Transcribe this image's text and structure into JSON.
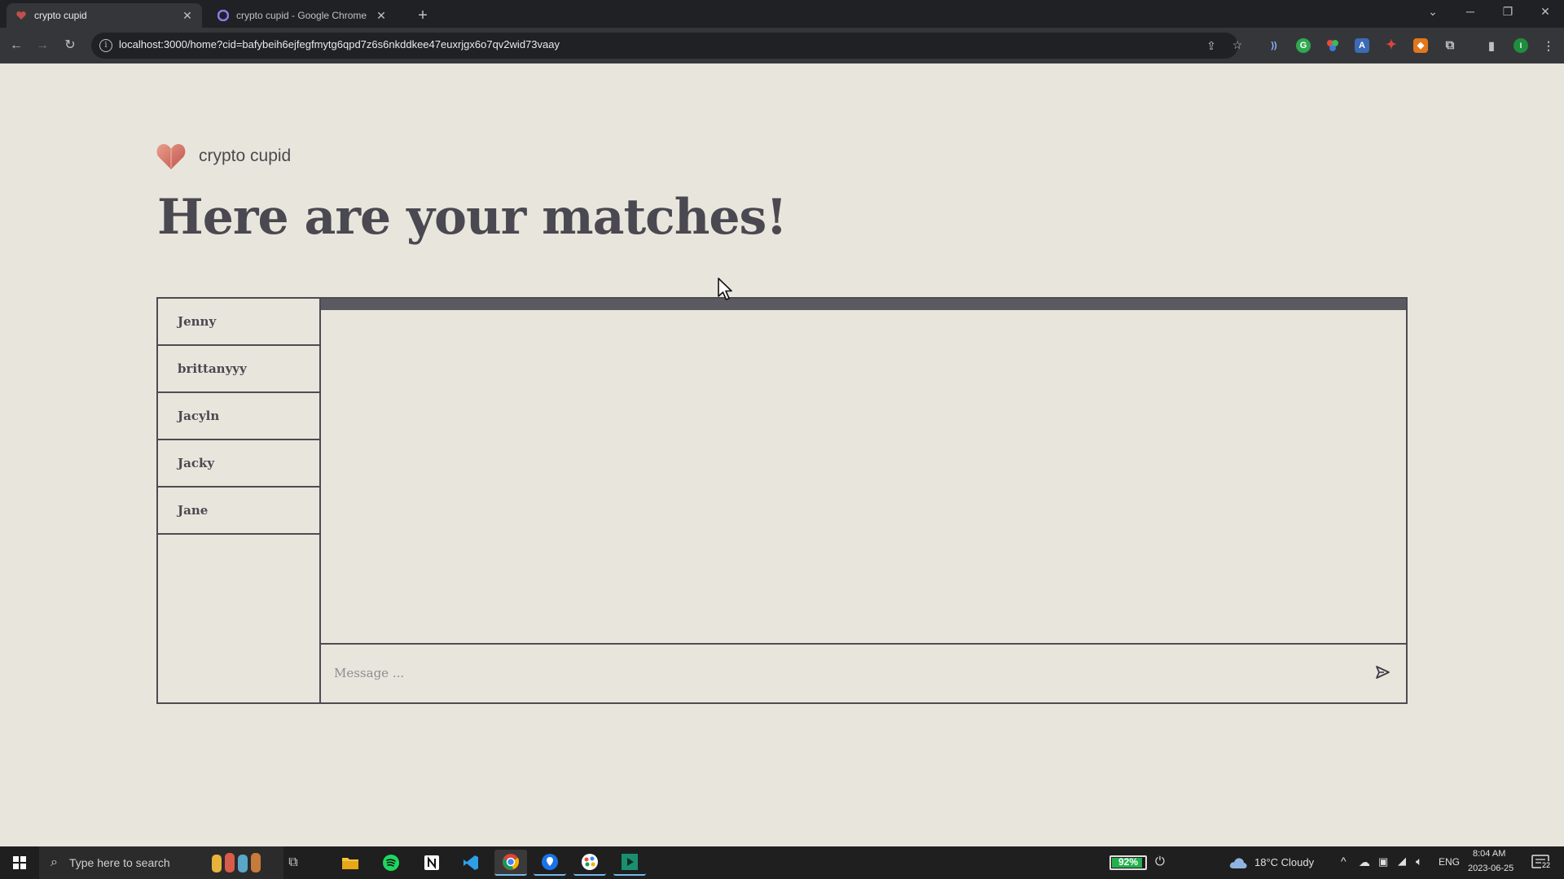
{
  "browser": {
    "tabs": [
      {
        "title": "crypto cupid",
        "active": true
      },
      {
        "title": "crypto cupid - Google Chrome",
        "active": false
      }
    ],
    "url": "localhost:3000/home?cid=bafybeih6ejfegfmytg6qpd7z6s6nkddkee47euxrjgx6o7qv2wid73vaay"
  },
  "app": {
    "brand": "crypto cupid",
    "headline": "Here are your matches!",
    "matches": [
      "Jenny",
      "brittanyyy",
      "Jacyln",
      "Jacky",
      "Jane"
    ],
    "message_placeholder": "Message ..."
  },
  "taskbar": {
    "search_placeholder": "Type here to search",
    "battery_percent": "92%",
    "battery_level": 0.92,
    "weather": "18°C  Cloudy",
    "language": "ENG",
    "time": "8:04 AM",
    "date": "2023-06-25",
    "notification_count": "22"
  },
  "colors": {
    "page_bg": "#e8e6dc",
    "ink": "#4a4850",
    "border": "#4d4b52",
    "header_bar": "#5c5a61"
  }
}
